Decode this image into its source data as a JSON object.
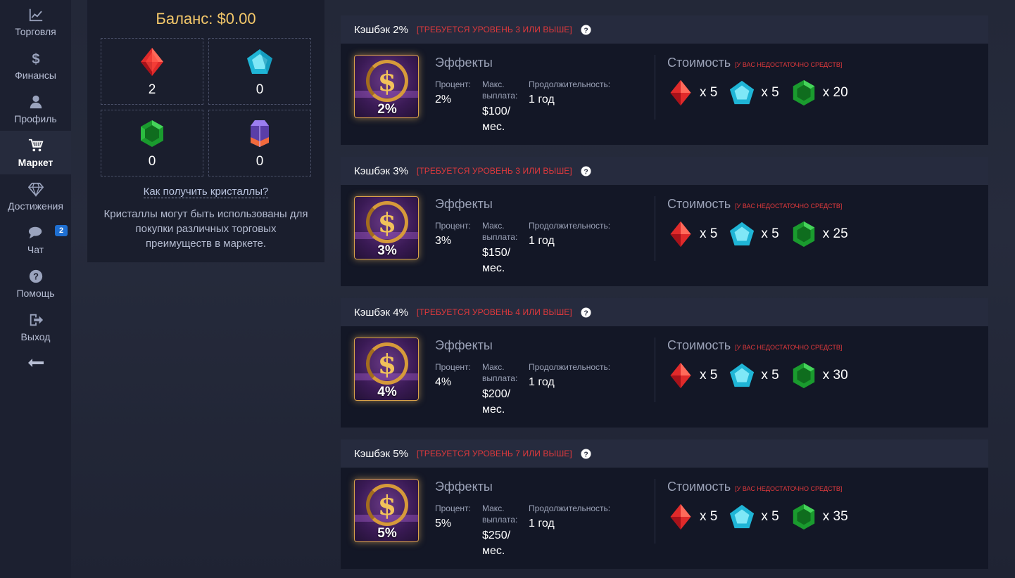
{
  "sidebar": {
    "items": [
      {
        "label": "Торговля",
        "icon": "chart-line-icon"
      },
      {
        "label": "Финансы",
        "icon": "dollar-icon"
      },
      {
        "label": "Профиль",
        "icon": "user-icon"
      },
      {
        "label": "Маркет",
        "icon": "cart-icon"
      },
      {
        "label": "Достижения",
        "icon": "diamond-icon"
      },
      {
        "label": "Чат",
        "icon": "chat-icon",
        "badge": "2"
      },
      {
        "label": "Помощь",
        "icon": "question-icon"
      },
      {
        "label": "Выход",
        "icon": "logout-icon"
      }
    ],
    "collapse_icon": "arrow-left-icon"
  },
  "crystals": {
    "balance": "Баланс: $0.00",
    "counts": {
      "red": "2",
      "blue": "0",
      "green": "0",
      "purple": "0"
    },
    "how_link": "Как получить кристаллы?",
    "description": "Кристаллы могут быть использованы для покупки различных торговых преимуществ в маркете."
  },
  "labels": {
    "effects": "Эффекты",
    "percent": "Процент:",
    "max_payout": "Макс. выплата:",
    "duration": "Продолжительность:",
    "cost": "Стоимость",
    "cost_warning": "[У ВАС НЕДОСТАТОЧНО СРЕДСТВ]"
  },
  "items": [
    {
      "title": "Кэшбэк 2%",
      "requirement": "[ТРЕБУЕТСЯ УРОВЕНЬ 3 ИЛИ ВЫШЕ]",
      "badge": "2%",
      "percent": "2%",
      "max_amount": "$100/",
      "max_unit": "мес.",
      "duration": "1 год",
      "cost_red": "x 5",
      "cost_blue": "x 5",
      "cost_green": "x 20"
    },
    {
      "title": "Кэшбэк 3%",
      "requirement": "[ТРЕБУЕТСЯ УРОВЕНЬ 3 ИЛИ ВЫШЕ]",
      "badge": "3%",
      "percent": "3%",
      "max_amount": "$150/",
      "max_unit": "мес.",
      "duration": "1 год",
      "cost_red": "x 5",
      "cost_blue": "x 5",
      "cost_green": "x 25"
    },
    {
      "title": "Кэшбэк 4%",
      "requirement": "[ТРЕБУЕТСЯ УРОВЕНЬ 4 ИЛИ ВЫШЕ]",
      "badge": "4%",
      "percent": "4%",
      "max_amount": "$200/",
      "max_unit": "мес.",
      "duration": "1 год",
      "cost_red": "x 5",
      "cost_blue": "x 5",
      "cost_green": "x 30"
    },
    {
      "title": "Кэшбэк 5%",
      "requirement": "[ТРЕБУЕТСЯ УРОВЕНЬ 7 ИЛИ ВЫШЕ]",
      "badge": "5%",
      "percent": "5%",
      "max_amount": "$250/",
      "max_unit": "мес.",
      "duration": "1 год",
      "cost_red": "x 5",
      "cost_blue": "x 5",
      "cost_green": "x 35"
    }
  ],
  "colors": {
    "accent_gold": "#f4c86a",
    "warning_red": "#e0393c",
    "badge_blue": "#1f6fd1"
  }
}
